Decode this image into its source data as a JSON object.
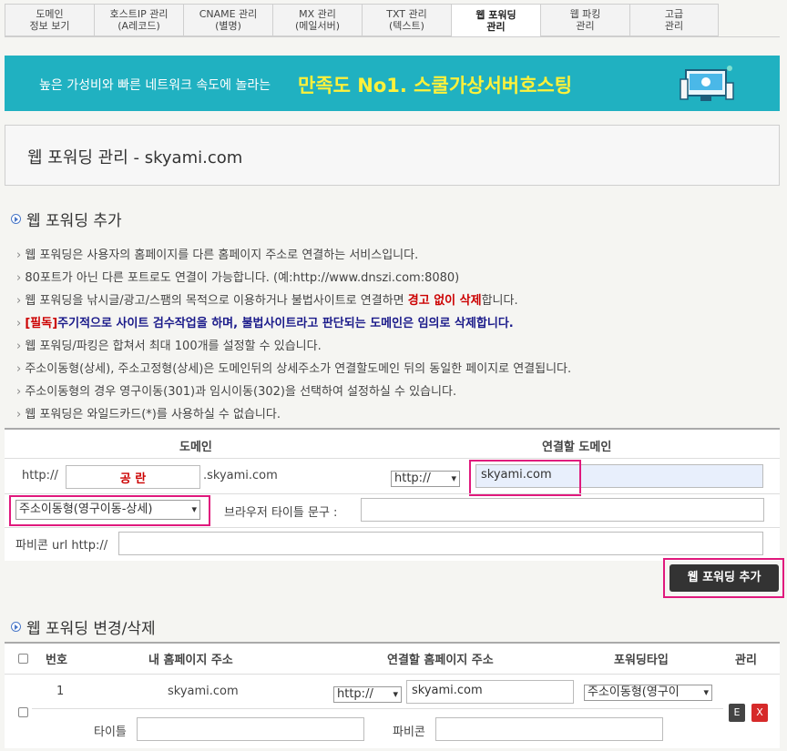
{
  "tabs": [
    {
      "l1": "도메인",
      "l2": "정보 보기"
    },
    {
      "l1": "호스트IP 관리",
      "l2": "(A레코드)"
    },
    {
      "l1": "CNAME 관리",
      "l2": "(별명)"
    },
    {
      "l1": "MX 관리",
      "l2": "(메일서버)"
    },
    {
      "l1": "TXT 관리",
      "l2": "(텍스트)"
    },
    {
      "l1": "웹 포워딩",
      "l2": "관리"
    },
    {
      "l1": "웹 파킹",
      "l2": "관리"
    },
    {
      "l1": "고급",
      "l2": "관리"
    }
  ],
  "banner": {
    "text1": "높은 가성비와 빠른 네트워크 속도에 놀라는",
    "text2": "만족도 No1. 스쿨가상서버호스팅"
  },
  "page_title": "웹 포워딩 관리 - skyami.com",
  "add_section": {
    "heading": "웹 포워딩 추가",
    "info": [
      "웹 포워딩은 사용자의 홈페이지를 다른 홈페이지 주소로 연결하는 서비스입니다.",
      "80포트가 아닌 다른 포트로도 연결이 가능합니다. (예:http://www.dnszi.com:8080)",
      {
        "pre": "웹 포워딩을 낚시글/광고/스팸의 목적으로 이용하거나 불법사이트로 연결하면 ",
        "warn": "경고 없이 삭제",
        "post": "합니다."
      },
      {
        "must": "[필독]",
        "text": "주기적으로 사이트 검수작업을 하며, 불법사이트라고 판단되는 도메인은 임의로 삭제합니다."
      },
      "웹 포워딩/파킹은 합쳐서 최대 100개를 설정할 수 있습니다.",
      "주소이동형(상세), 주소고정형(상세)은 도메인뒤의 상세주소가 연결할도메인 뒤의 동일한 페이지로 연결됩니다.",
      "주소이동형의 경우 영구이동(301)과 임시이동(302)을 선택하여 설정하실 수 있습니다.",
      "웹 포워딩은 와일드카드(*)를 사용하실 수 없습니다."
    ],
    "col_domain": "도메인",
    "col_target": "연결할 도메인",
    "http_prefix": "http://",
    "subdomain_value": "공   란",
    "domain_suffix": ".skyami.com",
    "protocol_value": "http://",
    "target_value": "skyami.com",
    "type_value": "주소이동형(영구이동-상세)",
    "browser_title_label": "브라우저 타이틀 문구 :",
    "favicon_label": "파비콘 url http://",
    "add_button": "웹 포워딩 추가"
  },
  "list_section": {
    "heading": "웹 포워딩 변경/삭제",
    "headers": {
      "no": "번호",
      "my_home": "내 홈페이지 주소",
      "target": "연결할 홈페이지 주소",
      "type": "포워딩타입",
      "manage": "관리"
    },
    "rows": [
      {
        "no": "1",
        "domain": "skyami.com",
        "protocol": "http://",
        "target": "skyami.com",
        "type": "주소이동형(영구이",
        "title_label": "타이틀",
        "favicon_label": "파비콘",
        "edit": "E",
        "delete": "X"
      }
    ]
  },
  "colors": {
    "banner": "#20b1c1",
    "banner_accent": "#fff13a",
    "highlight": "#e0197d",
    "warn": "#cc0000"
  }
}
